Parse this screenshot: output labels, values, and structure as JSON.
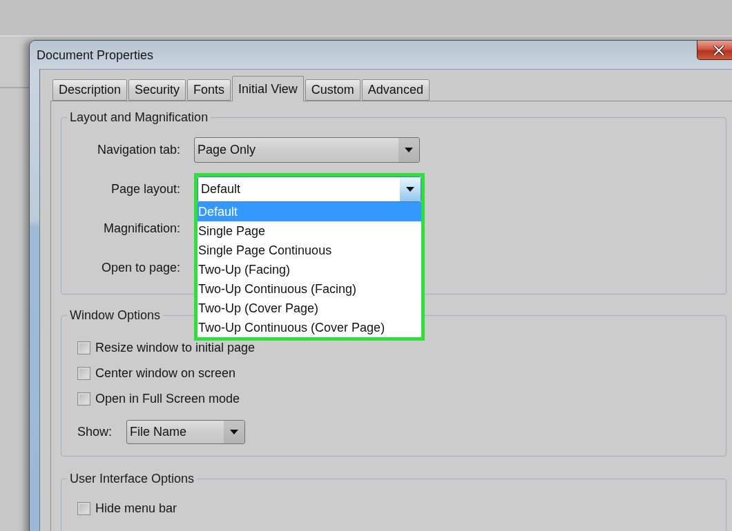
{
  "window": {
    "title": "Document Properties"
  },
  "tabs": [
    {
      "label": "Description",
      "selected": false
    },
    {
      "label": "Security",
      "selected": false
    },
    {
      "label": "Fonts",
      "selected": false
    },
    {
      "label": "Initial View",
      "selected": true
    },
    {
      "label": "Custom",
      "selected": false
    },
    {
      "label": "Advanced",
      "selected": false
    }
  ],
  "layout_and_magnification": {
    "title": "Layout and Magnification",
    "fields": [
      {
        "label": "Navigation tab:",
        "kind": "dropdown",
        "value": "Page Only",
        "expanded": false,
        "highlighted": false
      },
      {
        "label": "Page layout:",
        "kind": "dropdown",
        "value": "Default",
        "expanded": true,
        "highlighted": true,
        "options": [
          {
            "label": "Default",
            "selected": true
          },
          {
            "label": "Single Page",
            "selected": false
          },
          {
            "label": "Single Page Continuous",
            "selected": false
          },
          {
            "label": "Two-Up (Facing)",
            "selected": false
          },
          {
            "label": "Two-Up Continuous (Facing)",
            "selected": false
          },
          {
            "label": "Two-Up (Cover Page)",
            "selected": false
          },
          {
            "label": "Two-Up Continuous (Cover Page)",
            "selected": false
          }
        ]
      },
      {
        "label": "Magnification:",
        "kind": "covered"
      },
      {
        "label": "Open to page:",
        "kind": "covered"
      }
    ]
  },
  "window_options": {
    "title": "Window Options",
    "checkboxes": [
      {
        "label": "Resize window to initial page",
        "checked": false
      },
      {
        "label": "Center window on screen",
        "checked": false
      },
      {
        "label": "Open in Full Screen mode",
        "checked": false
      }
    ],
    "show": {
      "label": "Show:",
      "value": "File Name"
    }
  },
  "user_interface_options": {
    "title": "User Interface Options",
    "checkboxes": [
      {
        "label": "Hide menu bar",
        "checked": false
      }
    ]
  }
}
